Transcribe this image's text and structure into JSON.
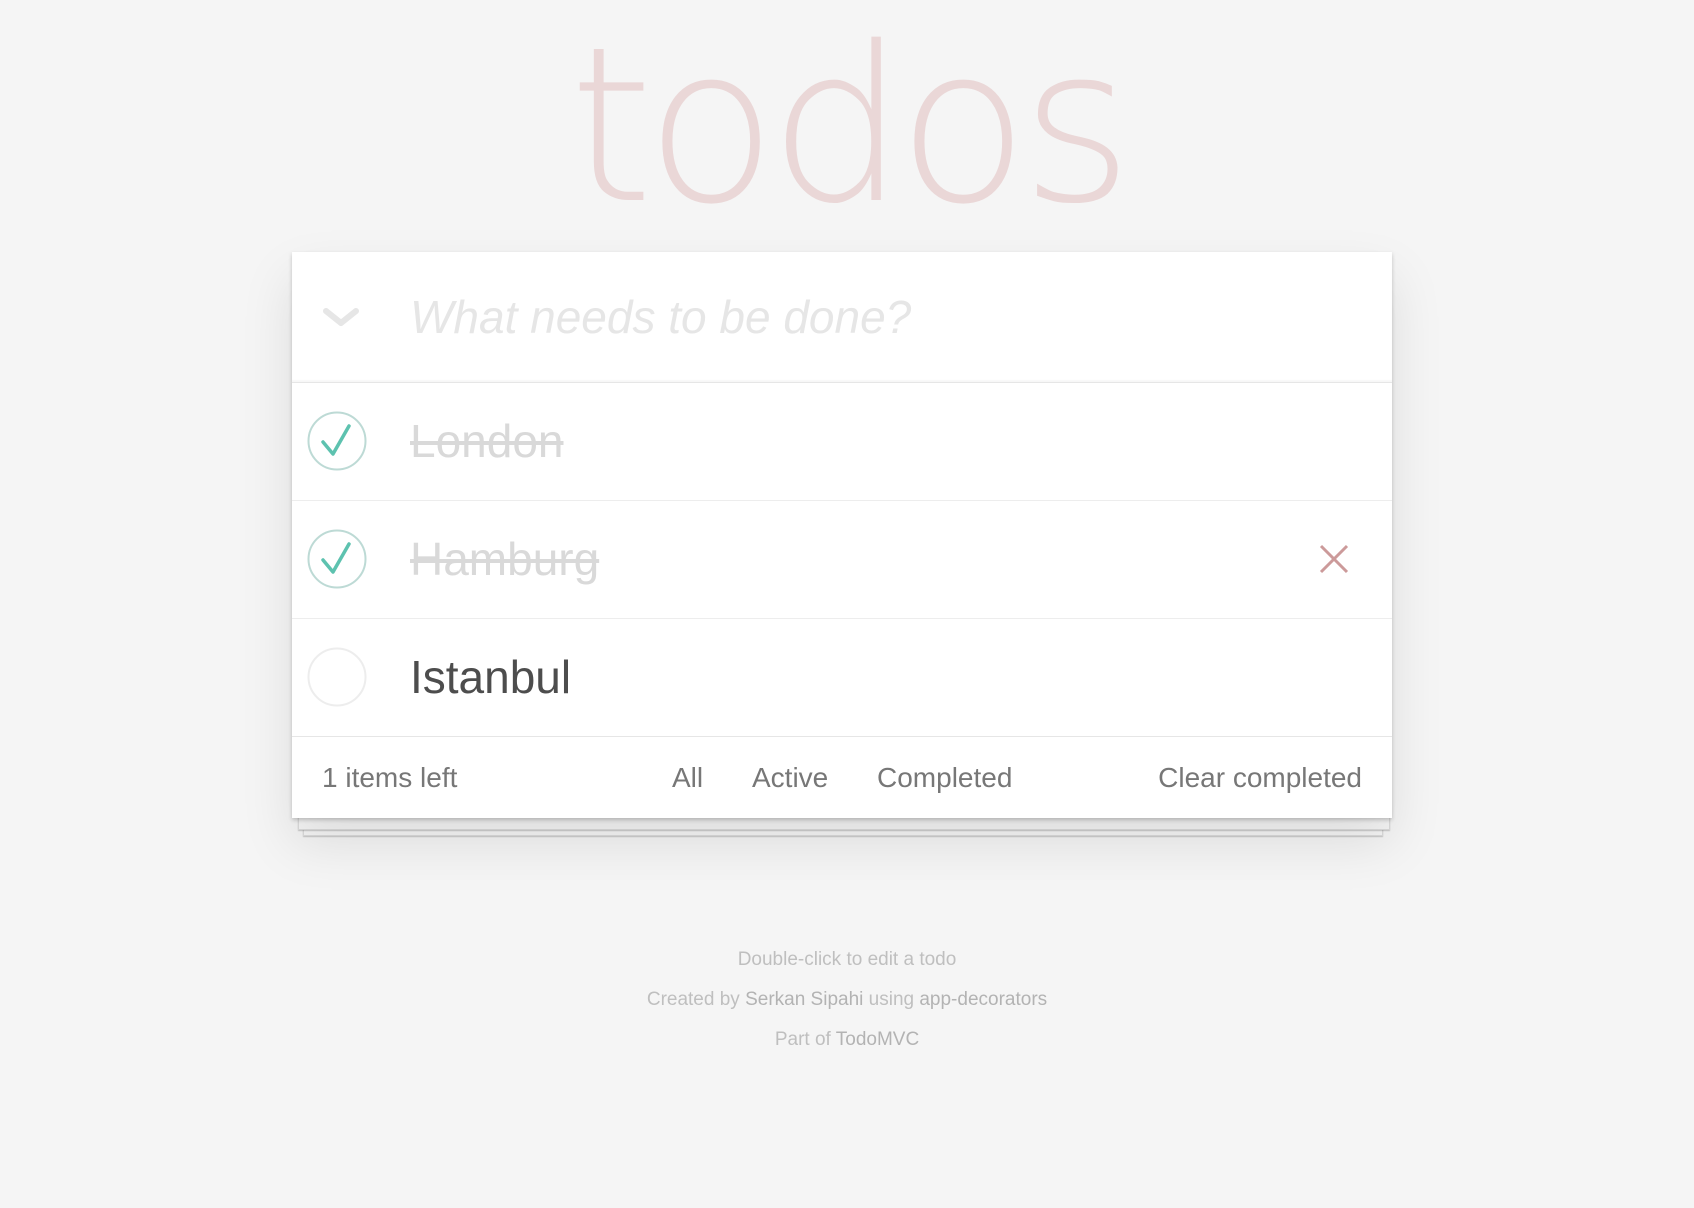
{
  "app": {
    "title": "todos"
  },
  "new_todo": {
    "placeholder": "What needs to be done?",
    "value": ""
  },
  "todos": [
    {
      "label": "London",
      "completed": true
    },
    {
      "label": "Hamburg",
      "completed": true
    },
    {
      "label": "Istanbul",
      "completed": false
    }
  ],
  "footer": {
    "count_text": "1 items left",
    "filters": {
      "all": "All",
      "active": "Active",
      "completed": "Completed"
    },
    "clear_completed": "Clear completed"
  },
  "info": {
    "edit_hint": "Double-click to edit a todo",
    "created_by_prefix": "Created by",
    "author": "Serkan Sipahi",
    "using_text": "using",
    "library": "app-decorators",
    "part_of_prefix": "Part of",
    "project": "TodoMVC"
  },
  "colors": {
    "title": "#efdada",
    "check": "#5dc2af",
    "check_circle": "#bddad5",
    "destroy": "#cc9a9a",
    "background": "#f5f5f5"
  },
  "icons": {
    "toggle_all": "chevron-down-icon",
    "toggle_checked": "checkmark-circle-icon",
    "toggle_unchecked": "empty-circle-icon",
    "destroy": "close-icon"
  }
}
